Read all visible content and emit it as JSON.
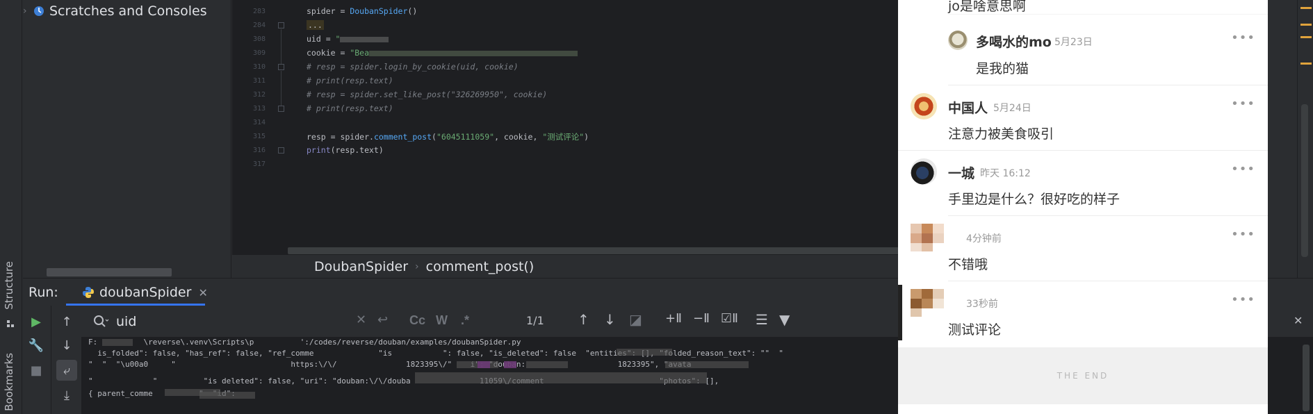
{
  "project": {
    "tree_item": "Scratches and Consoles"
  },
  "left_strip": {
    "structure_tab": "Structure",
    "bookmarks_tab": "Bookmarks"
  },
  "editor": {
    "line_numbers": [
      "283",
      "284",
      "308",
      "309",
      "310",
      "311",
      "312",
      "313",
      "314",
      "315",
      "316",
      "317"
    ],
    "code": {
      "l283_a": "spider = ",
      "l283_b": "DoubanSpider",
      "l283_c": "()",
      "l284": "...",
      "l308_a": "uid = ",
      "l308_b": "\"",
      "l309_a": "cookie = ",
      "l309_b": "\"Bea",
      "l310": "# resp = spider.login_by_cookie(uid, cookie)",
      "l311": "# print(resp.text)",
      "l312": "# resp = spider.set_like_post(\"326269950\", cookie)",
      "l313": "# print(resp.text)",
      "l315_a": "resp = spider.",
      "l315_b": "comment_post",
      "l315_c": "(",
      "l315_d": "\"6045111059\"",
      "l315_e": ", cookie, ",
      "l315_f": "\"测试评论\"",
      "l315_g": ")",
      "l316_a": "print",
      "l316_b": "(resp.text)"
    },
    "breadcrumb": [
      "DoubanSpider",
      "comment_post()"
    ]
  },
  "run": {
    "label": "Run:",
    "tab": "doubanSpider",
    "find_value": "uid",
    "match_count": "1/1",
    "find_buttons": {
      "case": "Cc",
      "words": "W",
      "regex": ".*"
    },
    "console_lines": [
      "F:          \\reverse\\.venv\\Scripts\\p          ':/codes/reverse/douban/examples/doubanSpider.py",
      "  is_folded\": false, \"has_ref\": false, \"ref_comme              \"is           \": false, \"is_deleted\": false  \"entities\": [], \"folded_reason_text\": \"\"  \"",
      "\"  \"  \"\\u00a0     \"                         https:\\/\\/               1823395\\/\"    i\": \"douban:                    1823395\", \"avata",
      "\"             \"          \"is deleted\": false, \"uri\": \"douban:\\/\\/douba               11059\\/comment                         \"photos\": [],",
      "{ parent_comme          \"  \"id\": "
    ]
  },
  "douban": {
    "comments": [
      {
        "user": "",
        "time": "",
        "text": "jo是啥意思啊"
      },
      {
        "user": "多喝水的mo",
        "time": "5月23日",
        "text": "是我的猫"
      },
      {
        "user": "中国人",
        "time": "5月24日",
        "text": "注意力被美食吸引"
      },
      {
        "user": "一城",
        "time": "昨天 16:12",
        "text": "手里边是什么？很好吃的样子"
      },
      {
        "user": "",
        "time": "4分钟前",
        "text": "不错哦"
      },
      {
        "user": "",
        "time": "33秒前",
        "text": "测试评论"
      }
    ],
    "more_glyph": "•••",
    "end_text": "THE END"
  },
  "colors": {
    "ide_bg": "#2b2d30",
    "editor_bg": "#1e1f22",
    "accent": "#3574f0",
    "run_green": "#5fb865"
  }
}
